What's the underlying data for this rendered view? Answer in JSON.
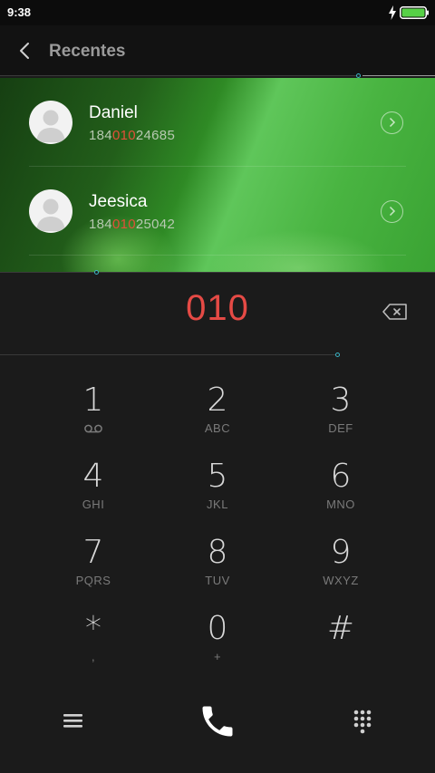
{
  "status_bar": {
    "time": "9:38",
    "charging_icon": "bolt-icon",
    "battery_icon": "battery-icon",
    "battery_color": "#57d147"
  },
  "header": {
    "back_icon": "chevron-left-icon",
    "title": "Recentes"
  },
  "recents": [
    {
      "name": "Daniel",
      "number_before": "184",
      "number_match": "010",
      "number_after": "24685",
      "avatar_icon": "person-icon",
      "detail_icon": "chevron-right-circle-icon"
    },
    {
      "name": "Jeesica",
      "number_before": "184",
      "number_match": "010",
      "number_after": "25042",
      "avatar_icon": "person-icon",
      "detail_icon": "chevron-right-circle-icon"
    }
  ],
  "dial": {
    "entered_number": "010",
    "delete_icon": "backspace-icon",
    "entered_color": "#e54a45",
    "match_color": "#e0503a"
  },
  "keypad": [
    {
      "digit": "1",
      "letters": "",
      "sub_icon": "voicemail-icon"
    },
    {
      "digit": "2",
      "letters": "ABC"
    },
    {
      "digit": "3",
      "letters": "DEF"
    },
    {
      "digit": "4",
      "letters": "GHI"
    },
    {
      "digit": "5",
      "letters": "JKL"
    },
    {
      "digit": "6",
      "letters": "MNO"
    },
    {
      "digit": "7",
      "letters": "PQRS"
    },
    {
      "digit": "8",
      "letters": "TUV"
    },
    {
      "digit": "9",
      "letters": "WXYZ"
    },
    {
      "digit": "*",
      "letters": ","
    },
    {
      "digit": "0",
      "letters": "+"
    },
    {
      "digit": "#",
      "letters": ""
    }
  ],
  "bottom_bar": {
    "menu_icon": "menu-icon",
    "call_icon": "phone-icon",
    "keypad_icon": "dialpad-icon"
  }
}
